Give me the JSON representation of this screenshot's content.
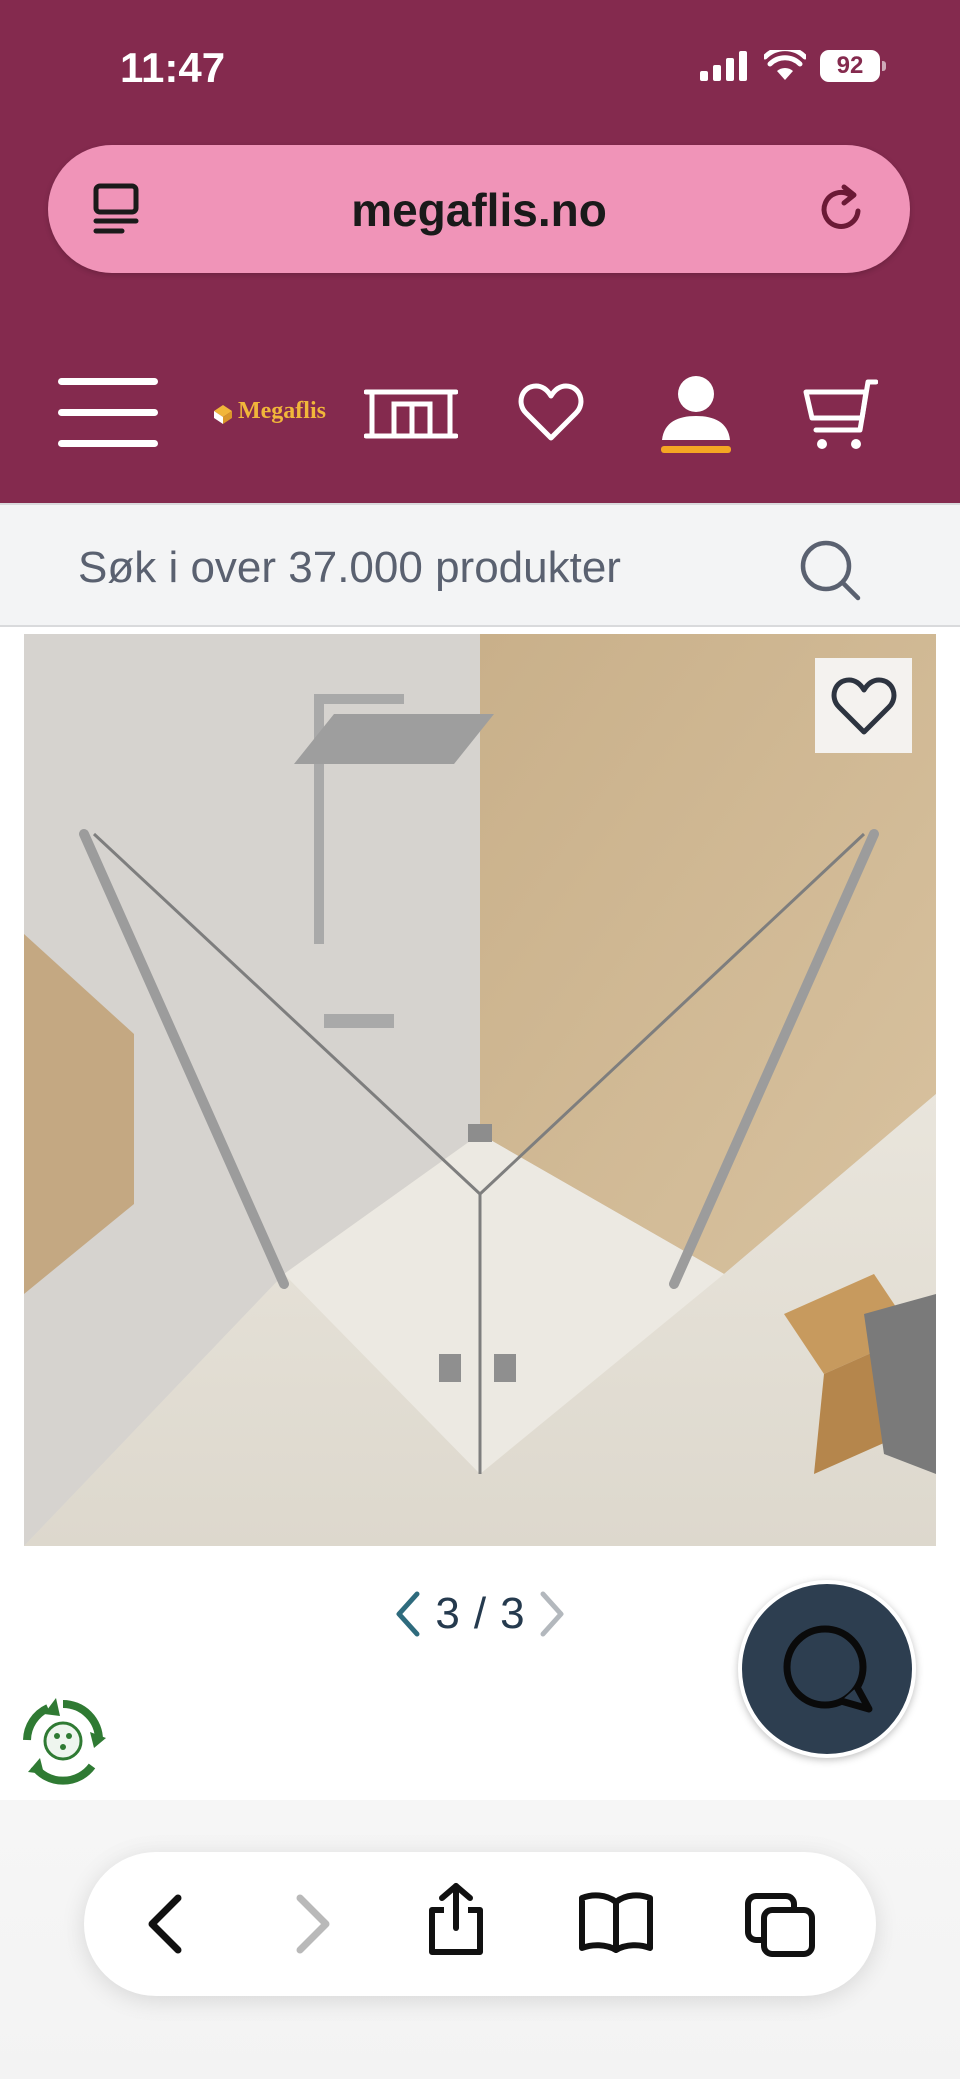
{
  "status_bar": {
    "time": "11:47",
    "battery": "92"
  },
  "browser": {
    "url": "megaflis.no"
  },
  "nav": {
    "logo_text": "Megaflis"
  },
  "search": {
    "placeholder": "Søk i over 37.000 produkter"
  },
  "gallery": {
    "current": "3",
    "separator": "/",
    "total": "3"
  },
  "colors": {
    "header_bg": "#842a4e",
    "url_bar": "#f094b8",
    "accent": "#f5a623",
    "chat_bg": "#2d3e50"
  }
}
